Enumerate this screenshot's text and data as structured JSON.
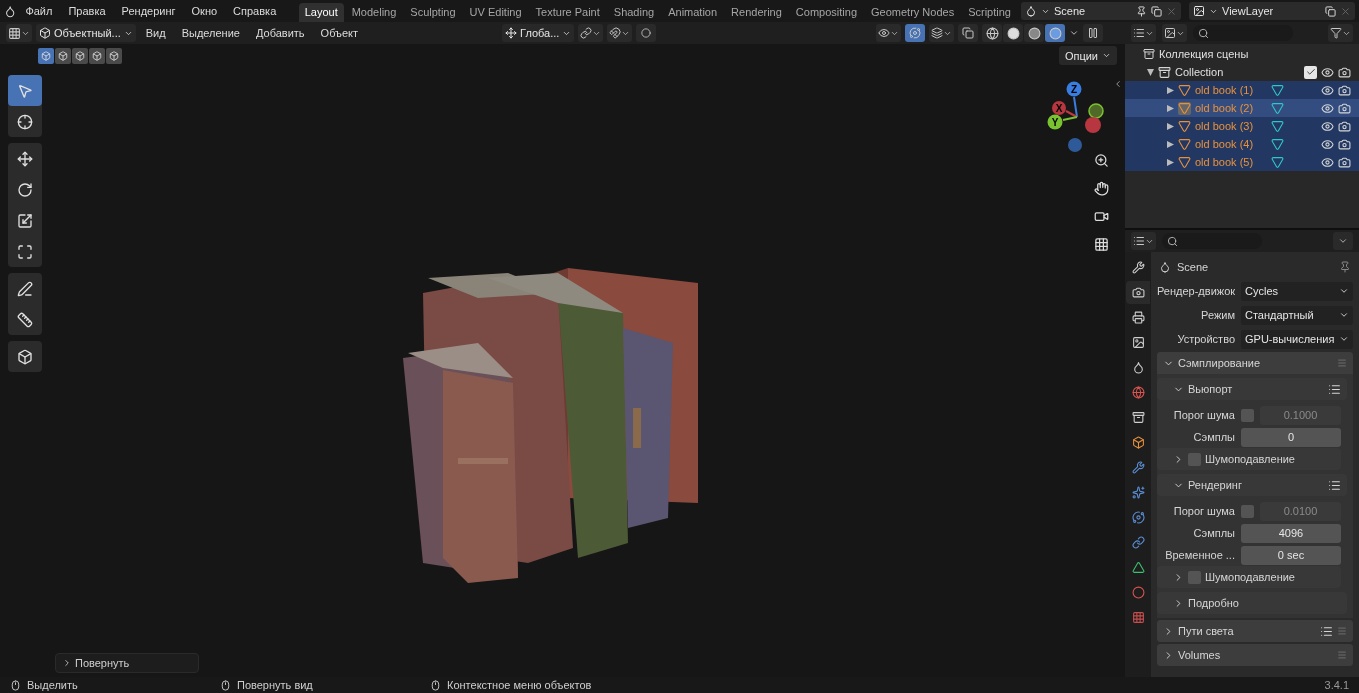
{
  "menu": [
    "Файл",
    "Правка",
    "Рендеринг",
    "Окно",
    "Справка"
  ],
  "workspaces": [
    {
      "label": "Layout",
      "selected": true
    },
    {
      "label": "Modeling",
      "selected": false
    },
    {
      "label": "Sculpting",
      "selected": false
    },
    {
      "label": "UV Editing",
      "selected": false
    },
    {
      "label": "Texture Paint",
      "selected": false
    },
    {
      "label": "Shading",
      "selected": false
    },
    {
      "label": "Animation",
      "selected": false
    },
    {
      "label": "Rendering",
      "selected": false
    },
    {
      "label": "Compositing",
      "selected": false
    },
    {
      "label": "Geometry Nodes",
      "selected": false
    },
    {
      "label": "Scripting",
      "selected": false
    }
  ],
  "scene_field": "Scene",
  "view_layer_field": "ViewLayer",
  "viewport_header": {
    "mode": "Объектный...",
    "menus": [
      "Вид",
      "Выделение",
      "Добавить",
      "Объект"
    ],
    "orientation": "Глоба...",
    "gizmo_on": true,
    "shading_modes": [
      {
        "kind": "wireframe",
        "selected": false
      },
      {
        "kind": "solid",
        "selected": false
      },
      {
        "kind": "material",
        "selected": false
      },
      {
        "kind": "rendered",
        "selected": true
      }
    ]
  },
  "select_modes": [
    {
      "selected": true
    },
    {
      "selected": false
    },
    {
      "selected": false
    },
    {
      "selected": false
    },
    {
      "selected": false
    }
  ],
  "options_button": "Опции",
  "tools": [
    {
      "kind": "select",
      "selected": true
    },
    {
      "kind": "cursor",
      "selected": false
    },
    {
      "kind": "move",
      "selected": false
    },
    {
      "kind": "rotate",
      "selected": false
    },
    {
      "kind": "scale",
      "selected": false
    },
    {
      "kind": "transform",
      "selected": false
    },
    {
      "kind": "annotate",
      "selected": false
    },
    {
      "kind": "measure",
      "selected": false
    },
    {
      "kind": "add_cube",
      "selected": false
    }
  ],
  "gizmo": {
    "x": "X",
    "y": "Y",
    "z": "Z"
  },
  "last_operator": "Повернуть",
  "outliner": {
    "root": "Коллекция сцены",
    "collection": {
      "label": "Collection",
      "expanded": true,
      "checked": true,
      "children": [
        {
          "label": "old book (1)",
          "selected": true,
          "active": false
        },
        {
          "label": "old book (2)",
          "selected": true,
          "active": true
        },
        {
          "label": "old book (3)",
          "selected": true,
          "active": false
        },
        {
          "label": "old book (4)",
          "selected": true,
          "active": false
        },
        {
          "label": "old book (5)",
          "selected": true,
          "active": false
        }
      ]
    }
  },
  "properties": {
    "tabs": [
      {
        "kind": "tool",
        "selected": false
      },
      {
        "kind": "render",
        "selected": true
      },
      {
        "kind": "output",
        "selected": false
      },
      {
        "kind": "view_layer",
        "selected": false
      },
      {
        "kind": "scene",
        "selected": false
      },
      {
        "kind": "world",
        "selected": false
      },
      {
        "kind": "collection",
        "selected": false
      },
      {
        "kind": "object",
        "selected": false
      },
      {
        "kind": "modifiers",
        "selected": false
      },
      {
        "kind": "particles",
        "selected": false
      },
      {
        "kind": "physics",
        "selected": false
      },
      {
        "kind": "constraints",
        "selected": false
      },
      {
        "kind": "data",
        "selected": false
      },
      {
        "kind": "material",
        "selected": false
      },
      {
        "kind": "texture",
        "selected": false
      }
    ],
    "title": "Scene",
    "fields": [
      {
        "label": "Рендер-движок",
        "value": "Cycles"
      },
      {
        "label": "Режим",
        "value": "Стандартный"
      },
      {
        "label": "Устройство",
        "value": "GPU-вычисления"
      }
    ],
    "panels": [
      {
        "title": "Сэмплирование",
        "expanded": true,
        "presets": false,
        "items": [
          {
            "kind": "panel",
            "title": "Вьюпорт",
            "expanded": true,
            "presets": true,
            "items": [
              {
                "kind": "checkfield",
                "label": "Порог шума",
                "checked": false,
                "value": "0.1000"
              },
              {
                "kind": "number",
                "label": "Сэмплы",
                "value": "0"
              },
              {
                "kind": "panel",
                "title": "Шумоподавление",
                "expanded": false,
                "checked": false,
                "presets": false
              }
            ]
          },
          {
            "kind": "panel",
            "title": "Рендеринг",
            "expanded": true,
            "presets": true,
            "items": [
              {
                "kind": "checkfield",
                "label": "Порог шума",
                "checked": false,
                "value": "0.0100"
              },
              {
                "kind": "number",
                "label": "Сэмплы",
                "value": "4096"
              },
              {
                "kind": "number",
                "label": "Временное ...",
                "value": "0 sec"
              },
              {
                "kind": "panel",
                "title": "Шумоподавление",
                "expanded": false,
                "checked": false,
                "presets": false
              }
            ]
          },
          {
            "kind": "panel",
            "title": "Подробно",
            "expanded": false,
            "presets": false
          }
        ]
      },
      {
        "title": "Пути света",
        "expanded": false,
        "presets": true
      },
      {
        "title": "Volumes",
        "expanded": false,
        "presets": false
      }
    ]
  },
  "status_bar": {
    "hints": [
      "Выделить",
      "Повернуть вид",
      "Контекстное меню объектов"
    ],
    "version": "3.4.1"
  }
}
